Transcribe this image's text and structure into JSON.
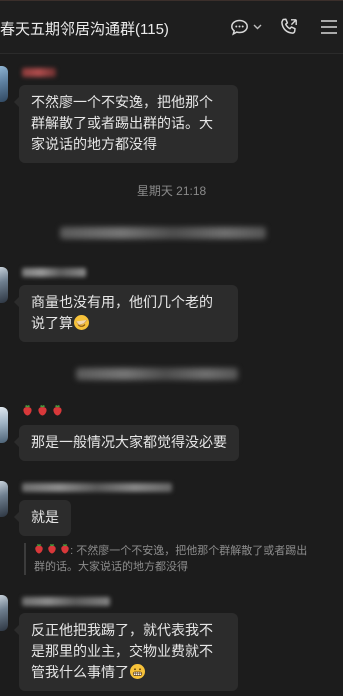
{
  "header": {
    "title": "春天五期邻居沟通群(115)"
  },
  "icons": {
    "chat_bubble": "chat-bubble-icon",
    "chevron": "chevron-down-icon",
    "phone": "phone-icon",
    "menu": "menu-icon",
    "strawberry": "strawberry-icon",
    "facepalm_emoji": "facepalm-emoji-icon",
    "grin_emoji": "grin-emoji-icon"
  },
  "colors": {
    "background": "#1c1c1c",
    "bubble": "#2c2c2c",
    "text": "#e6e6e6",
    "muted": "#8a8a8a"
  },
  "messages": {
    "m1": {
      "text": "不然廖一个不安逸，把他那个群解散了或者踢出群的话。大家说话的地方都没得"
    },
    "time1": "星期天 21:18",
    "m2": {
      "text": "商量也没有用，他们几个老的说了算"
    },
    "m3": {
      "text": "那是一般情况大家都觉得没必要"
    },
    "m4": {
      "text": "就是"
    },
    "quote": {
      "text": ": 不然廖一个不安逸，把他那个群解散了或者踢出群的话。大家说话的地方都没得"
    },
    "m5": {
      "text": "反正他把我踢了，就代表我不是那里的业主，交物业费就不管我什么事情了"
    }
  }
}
